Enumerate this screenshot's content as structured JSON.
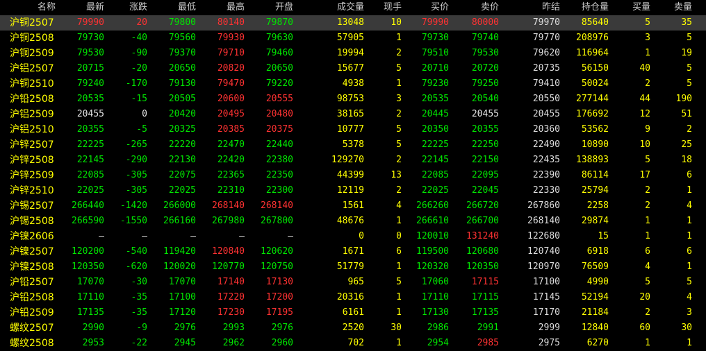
{
  "headers": {
    "name": "名称",
    "last": "最新",
    "change": "涨跌",
    "low": "最低",
    "high": "最高",
    "open": "开盘",
    "volume": "成交量",
    "hand": "现手",
    "bid": "买价",
    "ask": "卖价",
    "prev_settle": "昨结",
    "open_interest": "持仓量",
    "bid_qty": "买量",
    "ask_qty": "卖量"
  },
  "colors": {
    "up": "#ff3232",
    "down": "#00e600",
    "flat": "#e6e6e6",
    "name": "#ffff00",
    "selected_row_bg": "#3a3a3a"
  },
  "rows": [
    {
      "name": "沪铜2507",
      "last": "79990",
      "chg": "20",
      "low": "79800",
      "high": "80140",
      "open": "79870",
      "vol": "13048",
      "hand": "10",
      "bid": "79990",
      "ask": "80000",
      "prev": "79970",
      "oi": "85640",
      "bidq": "5",
      "askq": "35",
      "c_last": "up",
      "c_chg": "up",
      "c_low": "down",
      "c_high": "up",
      "c_open": "down",
      "c_bid": "up",
      "c_ask": "up",
      "selected": true
    },
    {
      "name": "沪铜2508",
      "last": "79730",
      "chg": "-40",
      "low": "79560",
      "high": "79930",
      "open": "79630",
      "vol": "57905",
      "hand": "1",
      "bid": "79730",
      "ask": "79740",
      "prev": "79770",
      "oi": "208976",
      "bidq": "3",
      "askq": "5",
      "c_last": "down",
      "c_chg": "down",
      "c_low": "down",
      "c_high": "up",
      "c_open": "down",
      "c_bid": "down",
      "c_ask": "down"
    },
    {
      "name": "沪铜2509",
      "last": "79530",
      "chg": "-90",
      "low": "79370",
      "high": "79710",
      "open": "79460",
      "vol": "19994",
      "hand": "2",
      "bid": "79510",
      "ask": "79530",
      "prev": "79620",
      "oi": "116964",
      "bidq": "1",
      "askq": "19",
      "c_last": "down",
      "c_chg": "down",
      "c_low": "down",
      "c_high": "up",
      "c_open": "down",
      "c_bid": "down",
      "c_ask": "down"
    },
    {
      "name": "沪铝2507",
      "last": "20715",
      "chg": "-20",
      "low": "20650",
      "high": "20820",
      "open": "20650",
      "vol": "15677",
      "hand": "5",
      "bid": "20710",
      "ask": "20720",
      "prev": "20735",
      "oi": "56150",
      "bidq": "40",
      "askq": "5",
      "c_last": "down",
      "c_chg": "down",
      "c_low": "down",
      "c_high": "up",
      "c_open": "down",
      "c_bid": "down",
      "c_ask": "down"
    },
    {
      "name": "沪铜2510",
      "last": "79240",
      "chg": "-170",
      "low": "79130",
      "high": "79470",
      "open": "79220",
      "vol": "4938",
      "hand": "1",
      "bid": "79230",
      "ask": "79250",
      "prev": "79410",
      "oi": "50024",
      "bidq": "2",
      "askq": "5",
      "c_last": "down",
      "c_chg": "down",
      "c_low": "down",
      "c_high": "up",
      "c_open": "down",
      "c_bid": "down",
      "c_ask": "down"
    },
    {
      "name": "沪铅2508",
      "last": "20535",
      "chg": "-15",
      "low": "20505",
      "high": "20600",
      "open": "20555",
      "vol": "98753",
      "hand": "3",
      "bid": "20535",
      "ask": "20540",
      "prev": "20550",
      "oi": "277144",
      "bidq": "44",
      "askq": "190",
      "c_last": "down",
      "c_chg": "down",
      "c_low": "down",
      "c_high": "up",
      "c_open": "up",
      "c_bid": "down",
      "c_ask": "down"
    },
    {
      "name": "沪铝2509",
      "last": "20455",
      "chg": "0",
      "low": "20420",
      "high": "20495",
      "open": "20480",
      "vol": "38165",
      "hand": "2",
      "bid": "20445",
      "ask": "20455",
      "prev": "20455",
      "oi": "176692",
      "bidq": "12",
      "askq": "51",
      "c_last": "flat",
      "c_chg": "flat",
      "c_low": "down",
      "c_high": "up",
      "c_open": "up",
      "c_bid": "down",
      "c_ask": "flat"
    },
    {
      "name": "沪铝2510",
      "last": "20355",
      "chg": "-5",
      "low": "20325",
      "high": "20385",
      "open": "20375",
      "vol": "10777",
      "hand": "5",
      "bid": "20350",
      "ask": "20355",
      "prev": "20360",
      "oi": "53562",
      "bidq": "9",
      "askq": "2",
      "c_last": "down",
      "c_chg": "down",
      "c_low": "down",
      "c_high": "up",
      "c_open": "up",
      "c_bid": "down",
      "c_ask": "down"
    },
    {
      "name": "沪锌2507",
      "last": "22225",
      "chg": "-265",
      "low": "22220",
      "high": "22470",
      "open": "22440",
      "vol": "5378",
      "hand": "5",
      "bid": "22225",
      "ask": "22250",
      "prev": "22490",
      "oi": "10890",
      "bidq": "10",
      "askq": "25",
      "c_last": "down",
      "c_chg": "down",
      "c_low": "down",
      "c_high": "down",
      "c_open": "down",
      "c_bid": "down",
      "c_ask": "down"
    },
    {
      "name": "沪锌2508",
      "last": "22145",
      "chg": "-290",
      "low": "22130",
      "high": "22420",
      "open": "22380",
      "vol": "129270",
      "hand": "2",
      "bid": "22145",
      "ask": "22150",
      "prev": "22435",
      "oi": "138893",
      "bidq": "5",
      "askq": "18",
      "c_last": "down",
      "c_chg": "down",
      "c_low": "down",
      "c_high": "down",
      "c_open": "down",
      "c_bid": "down",
      "c_ask": "down"
    },
    {
      "name": "沪锌2509",
      "last": "22085",
      "chg": "-305",
      "low": "22075",
      "high": "22365",
      "open": "22350",
      "vol": "44399",
      "hand": "13",
      "bid": "22085",
      "ask": "22095",
      "prev": "22390",
      "oi": "86114",
      "bidq": "17",
      "askq": "6",
      "c_last": "down",
      "c_chg": "down",
      "c_low": "down",
      "c_high": "down",
      "c_open": "down",
      "c_bid": "down",
      "c_ask": "down"
    },
    {
      "name": "沪锌2510",
      "last": "22025",
      "chg": "-305",
      "low": "22025",
      "high": "22310",
      "open": "22300",
      "vol": "12119",
      "hand": "2",
      "bid": "22025",
      "ask": "22045",
      "prev": "22330",
      "oi": "25794",
      "bidq": "2",
      "askq": "1",
      "c_last": "down",
      "c_chg": "down",
      "c_low": "down",
      "c_high": "down",
      "c_open": "down",
      "c_bid": "down",
      "c_ask": "down"
    },
    {
      "name": "沪锡2507",
      "last": "266440",
      "chg": "-1420",
      "low": "266000",
      "high": "268140",
      "open": "268140",
      "vol": "1561",
      "hand": "4",
      "bid": "266260",
      "ask": "266720",
      "prev": "267860",
      "oi": "2258",
      "bidq": "2",
      "askq": "4",
      "c_last": "down",
      "c_chg": "down",
      "c_low": "down",
      "c_high": "up",
      "c_open": "up",
      "c_bid": "down",
      "c_ask": "down"
    },
    {
      "name": "沪锡2508",
      "last": "266590",
      "chg": "-1550",
      "low": "266160",
      "high": "267980",
      "open": "267800",
      "vol": "48676",
      "hand": "1",
      "bid": "266610",
      "ask": "266700",
      "prev": "268140",
      "oi": "29874",
      "bidq": "1",
      "askq": "1",
      "c_last": "down",
      "c_chg": "down",
      "c_low": "down",
      "c_high": "down",
      "c_open": "down",
      "c_bid": "down",
      "c_ask": "down"
    },
    {
      "name": "沪镍2606",
      "last": "—",
      "chg": "—",
      "low": "—",
      "high": "—",
      "open": "—",
      "vol": "0",
      "hand": "0",
      "bid": "120010",
      "ask": "131240",
      "prev": "122680",
      "oi": "15",
      "bidq": "1",
      "askq": "1",
      "c_last": "flat",
      "c_chg": "flat",
      "c_low": "flat",
      "c_high": "flat",
      "c_open": "flat",
      "c_bid": "down",
      "c_ask": "up"
    },
    {
      "name": "沪镍2507",
      "last": "120200",
      "chg": "-540",
      "low": "119420",
      "high": "120840",
      "open": "120620",
      "vol": "1671",
      "hand": "6",
      "bid": "119500",
      "ask": "120680",
      "prev": "120740",
      "oi": "6918",
      "bidq": "6",
      "askq": "6",
      "c_last": "down",
      "c_chg": "down",
      "c_low": "down",
      "c_high": "up",
      "c_open": "down",
      "c_bid": "down",
      "c_ask": "down"
    },
    {
      "name": "沪镍2508",
      "last": "120350",
      "chg": "-620",
      "low": "120020",
      "high": "120770",
      "open": "120750",
      "vol": "51779",
      "hand": "1",
      "bid": "120320",
      "ask": "120350",
      "prev": "120970",
      "oi": "76509",
      "bidq": "4",
      "askq": "1",
      "c_last": "down",
      "c_chg": "down",
      "c_low": "down",
      "c_high": "down",
      "c_open": "down",
      "c_bid": "down",
      "c_ask": "down"
    },
    {
      "name": "沪铅2507",
      "last": "17070",
      "chg": "-30",
      "low": "17070",
      "high": "17140",
      "open": "17130",
      "vol": "965",
      "hand": "5",
      "bid": "17060",
      "ask": "17115",
      "prev": "17100",
      "oi": "4990",
      "bidq": "5",
      "askq": "5",
      "c_last": "down",
      "c_chg": "down",
      "c_low": "down",
      "c_high": "up",
      "c_open": "up",
      "c_bid": "down",
      "c_ask": "up"
    },
    {
      "name": "沪铅2508",
      "last": "17110",
      "chg": "-35",
      "low": "17100",
      "high": "17220",
      "open": "17200",
      "vol": "20316",
      "hand": "1",
      "bid": "17110",
      "ask": "17115",
      "prev": "17145",
      "oi": "52194",
      "bidq": "20",
      "askq": "4",
      "c_last": "down",
      "c_chg": "down",
      "c_low": "down",
      "c_high": "up",
      "c_open": "up",
      "c_bid": "down",
      "c_ask": "down"
    },
    {
      "name": "沪铅2509",
      "last": "17135",
      "chg": "-35",
      "low": "17120",
      "high": "17230",
      "open": "17195",
      "vol": "6161",
      "hand": "1",
      "bid": "17130",
      "ask": "17135",
      "prev": "17170",
      "oi": "21184",
      "bidq": "2",
      "askq": "3",
      "c_last": "down",
      "c_chg": "down",
      "c_low": "down",
      "c_high": "up",
      "c_open": "up",
      "c_bid": "down",
      "c_ask": "down"
    },
    {
      "name": "螺纹2507",
      "last": "2990",
      "chg": "-9",
      "low": "2976",
      "high": "2993",
      "open": "2976",
      "vol": "2520",
      "hand": "30",
      "bid": "2986",
      "ask": "2991",
      "prev": "2999",
      "oi": "12840",
      "bidq": "60",
      "askq": "30",
      "c_last": "down",
      "c_chg": "down",
      "c_low": "down",
      "c_high": "down",
      "c_open": "down",
      "c_bid": "down",
      "c_ask": "down"
    },
    {
      "name": "螺纹2508",
      "last": "2953",
      "chg": "-22",
      "low": "2945",
      "high": "2962",
      "open": "2960",
      "vol": "702",
      "hand": "1",
      "bid": "2954",
      "ask": "2985",
      "prev": "2975",
      "oi": "6270",
      "bidq": "1",
      "askq": "1",
      "c_last": "down",
      "c_chg": "down",
      "c_low": "down",
      "c_high": "down",
      "c_open": "down",
      "c_bid": "down",
      "c_ask": "up"
    }
  ]
}
